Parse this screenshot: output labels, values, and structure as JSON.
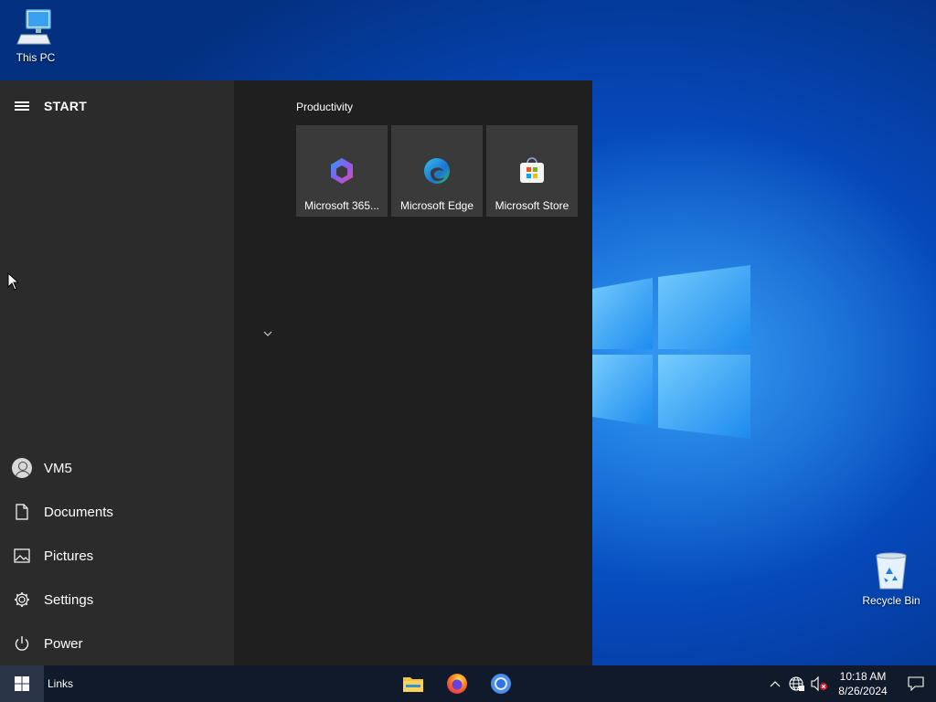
{
  "desktop": {
    "icons": [
      {
        "label": "This PC",
        "icon": "computer-icon"
      },
      {
        "label": "Recycle Bin",
        "icon": "recycle-bin-icon"
      }
    ]
  },
  "start_menu": {
    "title": "START",
    "group_label": "Productivity",
    "tiles": [
      {
        "label": "Microsoft 365...",
        "icon": "microsoft-365-icon"
      },
      {
        "label": "Microsoft Edge",
        "icon": "edge-icon"
      },
      {
        "label": "Microsoft Store",
        "icon": "store-icon"
      }
    ],
    "left_items": [
      {
        "label": "VM5",
        "icon": "user-avatar-icon"
      },
      {
        "label": "Documents",
        "icon": "document-icon"
      },
      {
        "label": "Pictures",
        "icon": "pictures-icon"
      },
      {
        "label": "Settings",
        "icon": "gear-icon"
      },
      {
        "label": "Power",
        "icon": "power-icon"
      }
    ]
  },
  "taskbar": {
    "toolbar_label": "Links",
    "pinned": [
      {
        "name": "File Explorer",
        "icon": "file-explorer-icon"
      },
      {
        "name": "Firefox",
        "icon": "firefox-icon"
      },
      {
        "name": "Chrome",
        "icon": "chrome-icon"
      }
    ],
    "clock": {
      "time": "10:18 AM",
      "date": "8/26/2024"
    }
  },
  "colors": {
    "start_left_bg": "#2b2b2b",
    "start_right_bg": "#1f1f1f",
    "tile_bg": "#3a3a3a",
    "taskbar_bg": "#101a2a",
    "desktop_blue": "#0c73e6"
  }
}
